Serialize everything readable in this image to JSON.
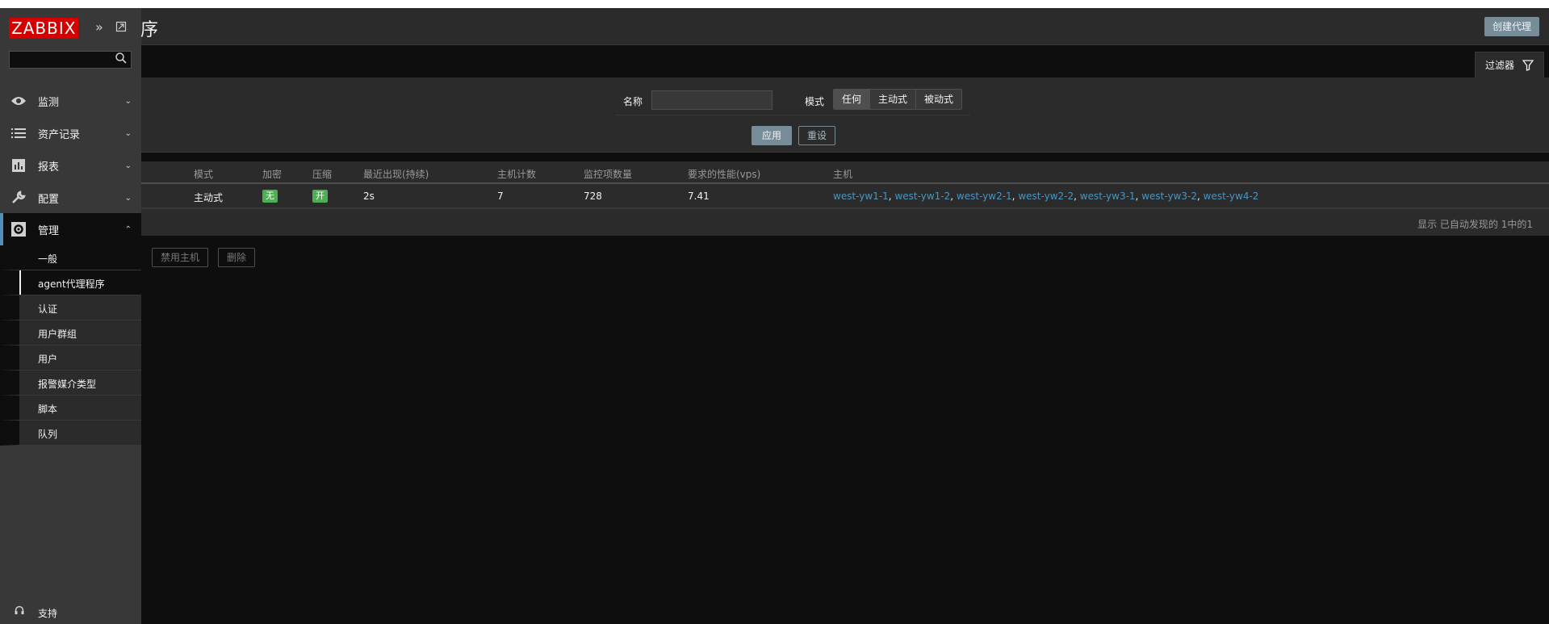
{
  "page": {
    "title": "agent代理程序",
    "visible_title_fragment": "序",
    "create_button": "创建代理"
  },
  "filter": {
    "tab_label": "过滤器",
    "name_label": "名称",
    "name_value": "",
    "mode_label": "模式",
    "mode_options": [
      "任何",
      "主动式",
      "被动式"
    ],
    "mode_selected": "任何",
    "apply_label": "应用",
    "reset_label": "重设"
  },
  "table": {
    "columns": [
      "模式",
      "加密",
      "压缩",
      "最近出现(持续)",
      "主机计数",
      "监控项数量",
      "要求的性能(vps)",
      "主机"
    ],
    "rows": [
      {
        "mode": "主动式",
        "encryption": "无",
        "compression": "开",
        "last_seen": "2s",
        "host_count": "7",
        "item_count": "728",
        "required_performance": "7.41",
        "hosts": [
          "west-yw1-1",
          "west-yw1-2",
          "west-yw2-1",
          "west-yw2-2",
          "west-yw3-1",
          "west-yw3-2",
          "west-yw4-2"
        ]
      }
    ],
    "footer": "显示 已自动发现的 1中的1"
  },
  "actions": {
    "disable_hosts": "禁用主机",
    "delete": "删除"
  },
  "sidebar": {
    "logo": "ZABBIX",
    "search_value": "",
    "menu": [
      {
        "label": "监测",
        "icon": "eye-icon",
        "open": false
      },
      {
        "label": "资产记录",
        "icon": "list-icon",
        "open": false
      },
      {
        "label": "报表",
        "icon": "bar-chart-icon",
        "open": false
      },
      {
        "label": "配置",
        "icon": "wrench-icon",
        "open": false
      },
      {
        "label": "管理",
        "icon": "gear-icon",
        "open": true
      }
    ],
    "submenu": [
      "一般",
      "agent代理程序",
      "认证",
      "用户群组",
      "用户",
      "报警媒介类型",
      "脚本",
      "队列"
    ],
    "submenu_active": "agent代理程序",
    "support": "支持"
  },
  "colors": {
    "accent": "#768d99",
    "link": "#4796c4",
    "logo_red": "#d40000",
    "badge_green": "#4caf50"
  }
}
